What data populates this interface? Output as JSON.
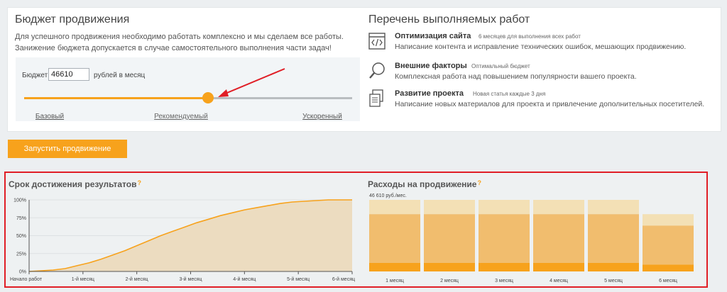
{
  "budget": {
    "title": "Бюджет продвижения",
    "desc_line1": "Для успешного продвижения необходимо работать комплексно и мы сделаем все работы.",
    "desc_line2": "Занижение бюджета допускается в случае самостоятельного выполнения части задач!",
    "input_label": "Бюджет:",
    "value": "46610",
    "unit": "рублей в месяц",
    "slider": {
      "position": 0.56,
      "ticks": [
        "Базовый",
        "Рекомендуемый",
        "Ускоренный"
      ]
    }
  },
  "works": {
    "title": "Перечень выполняемых работ",
    "items": [
      {
        "name": "Оптимизация сайта",
        "note": "6 месяцев для выполнения всех работ",
        "desc": "Написание контента и исправление технических ошибок, мешающих продвижению.",
        "icon": "code-window-icon"
      },
      {
        "name": "Внешние факторы",
        "note": "Оптимальный бюджет",
        "desc": "Комплексная работа над повышением популярности вашего проекта.",
        "icon": "magnifier-icon"
      },
      {
        "name": "Развитие проекта",
        "note": "Новая статья каждые 3 дня",
        "desc": "Написание новых материалов для проекта и привлечение дополнительных посетителей.",
        "icon": "documents-icon"
      }
    ]
  },
  "start_button": "Запустить продвижение",
  "charts": {
    "results_title": "Срок достижения результатов",
    "costs_title": "Расходы на продвижение",
    "question_mark": "?"
  },
  "chart_data": [
    {
      "type": "area",
      "title": "Срок достижения результатов",
      "x": [
        "Начало работ",
        "1-й месяц",
        "2-й месяц",
        "3-й месяц",
        "4-й месяц",
        "5-й месяц",
        "6-й месяц"
      ],
      "y_ticks": [
        "0%",
        "25%",
        "50%",
        "75%",
        "100%"
      ],
      "ylim": [
        0,
        100
      ],
      "series": [
        {
          "values": [
            0,
            1,
            2,
            4,
            8,
            12,
            17,
            23,
            29,
            36,
            43,
            50,
            56,
            62,
            68,
            73,
            78,
            82,
            86,
            89,
            92,
            95,
            97,
            98,
            99,
            100,
            100,
            100
          ]
        }
      ],
      "color": "#f7a21c",
      "fill": "#ecdcc0"
    },
    {
      "type": "bar",
      "title": "Расходы на продвижение",
      "annotation": "46 610 руб./мес.",
      "categories": [
        "1 месяц",
        "2 месяц",
        "3 месяц",
        "4 месяц",
        "5 месяц",
        "6 месяц"
      ],
      "values": [
        46610,
        46610,
        46610,
        46610,
        46610,
        37300
      ],
      "colors": {
        "light": "#f3e0b5",
        "main": "#f1bd6e",
        "base": "#f7a21c"
      }
    }
  ]
}
